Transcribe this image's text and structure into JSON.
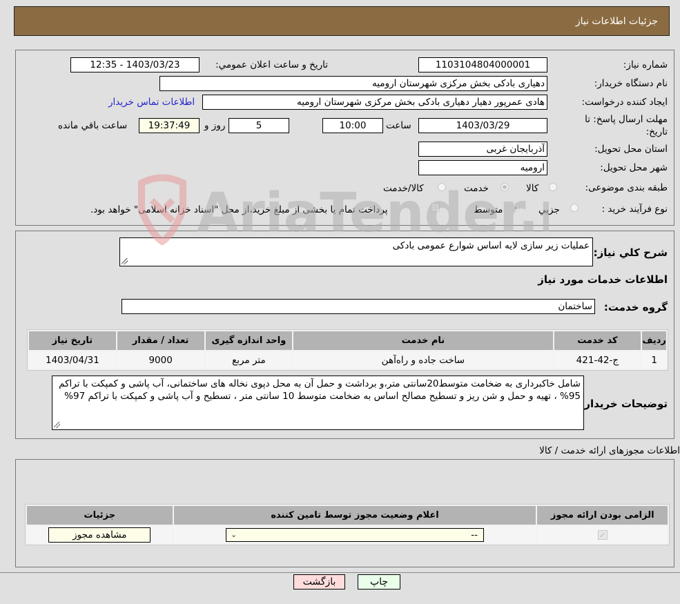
{
  "header": {
    "title": "جزئيات اطلاعات نياز"
  },
  "details": {
    "need_number": {
      "label": "شماره نياز:",
      "value": "1103104804000001"
    },
    "announce_datetime": {
      "label": "تاريخ و ساعت اعلان عمومي:",
      "value": "1403/03/23 - 12:35"
    },
    "buyer_org": {
      "label": "نام دستگاه خريدار:",
      "value": "دهیاری بادکی بخش مرکزی شهرستان ارومیه"
    },
    "requester": {
      "label": "ايجاد کننده درخواست:",
      "value": "هادی عمرپور دهیار دهیاری بادکی بخش مرکزی شهرستان ارومیه"
    },
    "buyer_contact_link": "اطلاعات تماس خريدار",
    "deadline": {
      "label": "مهلت ارسال پاسخ: تا تاريخ:",
      "date": "1403/03/29",
      "time_label": "ساعت",
      "time": "10:00",
      "days": "5",
      "days_label": "روز و",
      "remaining": "19:37:49",
      "remaining_label": "ساعت باقي مانده"
    },
    "province": {
      "label": "استان محل تحويل:",
      "value": "آذربایجان غربی"
    },
    "city": {
      "label": "شهر محل تحويل:",
      "value": "ارومیه"
    },
    "category": {
      "label": "طبقه بندی موضوعی:",
      "options": [
        {
          "label": "کالا",
          "checked": false
        },
        {
          "label": "خدمت",
          "checked": true
        },
        {
          "label": "کالا/خدمت",
          "checked": false
        }
      ]
    },
    "purchase_type": {
      "label": "نوع فرآيند خريد :",
      "options": [
        {
          "label": "جزيي",
          "checked": false
        },
        {
          "label": "متوسط",
          "checked": true
        }
      ],
      "treasury_checkbox_label": "پرداخت تمام يا بخشی از مبلغ خريد،از محل \"اسناد خزانه اسلامی\" خواهد بود."
    }
  },
  "description": {
    "label": "شرح کلي نياز:",
    "value": "عملیات زیر سازی لایه اساس شوارع عمومی بادکی",
    "services_heading": "اطلاعات خدمات مورد نياز",
    "service_group_label": "گروه خدمت:",
    "service_group_value": "ساختمان"
  },
  "services_table": {
    "headers": [
      "رديف",
      "کد خدمت",
      "نام خدمت",
      "واحد اندازه گيری",
      "تعداد / مقدار",
      "تاريخ نياز"
    ],
    "rows": [
      [
        "1",
        "ج-42-421",
        "ساخت جاده و راه‌آهن",
        "متر مربع",
        "9000",
        "1403/04/31"
      ]
    ]
  },
  "buyer_notes": {
    "label": "توضيحات خريدار:",
    "value": "شامل خاکبرداری به ضخامت متوسط20سانتی متر،و برداشت و حمل آن به محل دپوی نخاله های ساختمانی، آب پاشی و کمپکت با تراکم 95% ، تهیه و حمل و شن ریز و تسطیح مصالح اساس به ضخامت متوسط 10 سانتی متر ، تسطیح و آب پاشی و کمپکت با تراکم 97%"
  },
  "permits": {
    "section_title": "اطلاعات مجوزهای ارائه خدمت / کالا",
    "headers": [
      "الزامی بودن ارائه مجوز",
      "اعلام وضعيت مجوز توسط تامين کننده",
      "جزئيات"
    ],
    "rows": [
      {
        "required_checked": true,
        "status_value": "--",
        "details_button": "مشاهده مجوز"
      }
    ]
  },
  "footer": {
    "print_button": "چاپ",
    "back_button": "بازگشت"
  },
  "colors": {
    "header_bg": "#8b6c42",
    "print_bg": "#eaffea",
    "back_bg": "#ffdcdc",
    "link": "#2222cc"
  }
}
